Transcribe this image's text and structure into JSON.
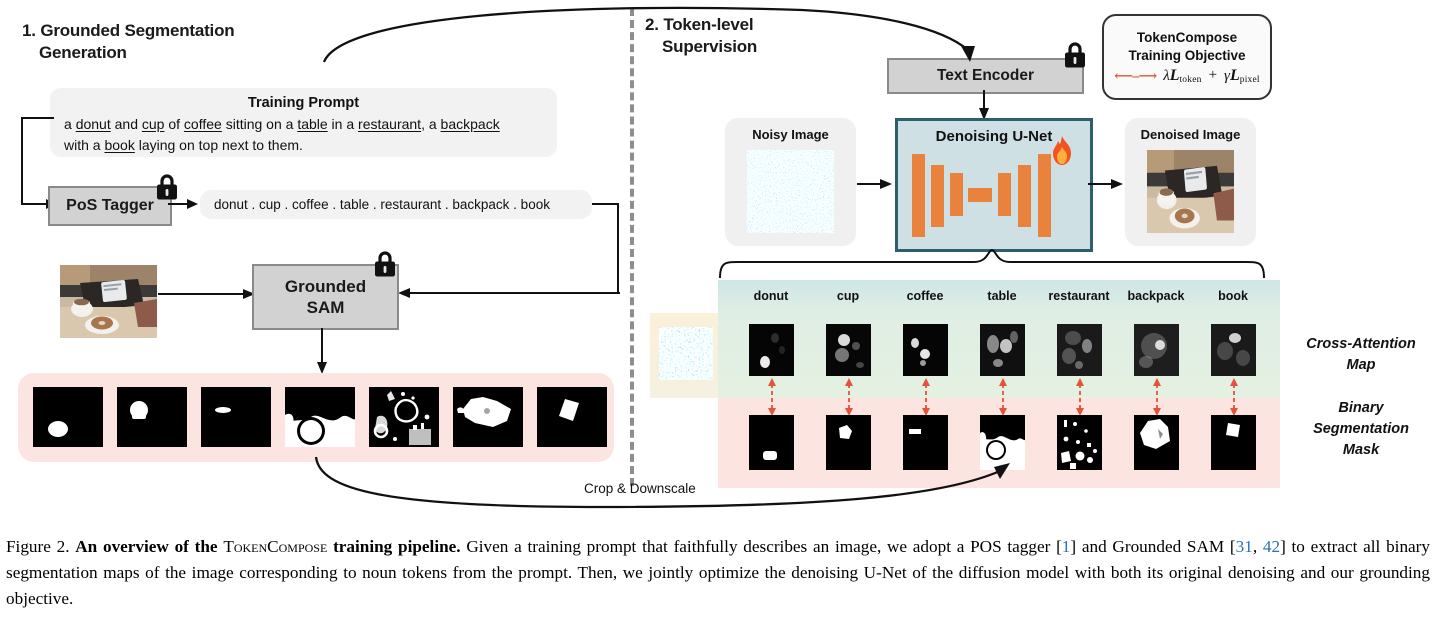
{
  "sections": {
    "left": {
      "number": "1.",
      "line1": "Grounded Segmentation",
      "line2": "Generation"
    },
    "right": {
      "number": "2.",
      "line1": "Token-level",
      "line2": "Supervision"
    }
  },
  "prompt": {
    "title": "Training Prompt",
    "line1_pre": "a ",
    "nouns": [
      "donut",
      "cup",
      "coffee",
      "table",
      "restaurant",
      "backpack",
      "book"
    ],
    "full_text": "a donut and cup of coffee sitting on a table in a restaurant, a backpack with a book laying on top next to them."
  },
  "pos_tagger": {
    "label": "PoS Tagger",
    "icon": "lock-icon"
  },
  "tokens_output": "donut . cup . coffee . table . restaurant . backpack . book",
  "grounded_sam": {
    "line1": "Grounded",
    "line2": "SAM",
    "icon": "lock-icon"
  },
  "text_encoder": {
    "label": "Text Encoder",
    "icon": "lock-icon"
  },
  "unet": {
    "title": "Denoising U-Net",
    "icon": "fire-icon"
  },
  "noisy_image": {
    "label": "Noisy Image"
  },
  "denoised_image": {
    "label": "Denoised Image"
  },
  "objective": {
    "line1": "TokenCompose",
    "line2": "Training Objective",
    "legend_arrow": "<- ->",
    "lambda": "λ",
    "gamma": "γ",
    "loss_symbol": "L",
    "sub_token": "token",
    "sub_pixel": "pixel",
    "plus": "+",
    "formula_text": "λℒtoken + γℒpixel"
  },
  "token_grid": {
    "columns": [
      "donut",
      "cup",
      "coffee",
      "table",
      "restaurant",
      "backpack",
      "book"
    ],
    "row_labels": {
      "attention": "Cross-Attention\nMap",
      "attention_l1": "Cross-Attention",
      "attention_l2": "Map",
      "mask_l1": "Binary",
      "mask_l2": "Segmentation",
      "mask_l3": "Mask"
    }
  },
  "crop_downscale_label": "Crop & Downscale",
  "colors": {
    "orange": "#e8823c",
    "unet_fill": "#cfe0e5",
    "unet_border": "#2d5f6b",
    "band_head": "#cfe6e6",
    "band_attn": "#e1eee3",
    "band_mask": "#fce5e1",
    "band_crop": "#fbf0d8",
    "grey_box": "#d2d2d2",
    "panel": "#f2f2f2",
    "red_arrow": "#e2533a",
    "ref_link": "#2a6ebb"
  },
  "caption": {
    "fig_label": "Figure 2.",
    "bold1": "An overview of the",
    "smallcaps": "TokenCompose",
    "bold2": "training pipeline.",
    "rest1": "Given a training prompt that faithfully describes an image, we adopt a POS tagger [",
    "ref1": "1",
    "rest2": "] and Grounded SAM [",
    "ref2": "31",
    "ref_comma": ", ",
    "ref3": "42",
    "rest3": "] to extract all binary segmentation maps of the image corresponding to noun tokens from the prompt. Then, we jointly optimize the denoising U-Net of the diffusion model with both its original denoising and our grounding objective."
  }
}
